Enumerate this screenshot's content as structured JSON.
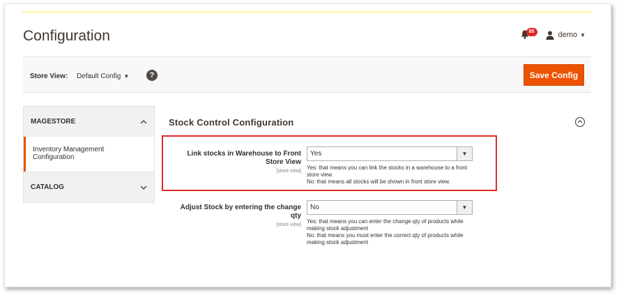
{
  "header": {
    "title": "Configuration",
    "notifications_count": "85",
    "user_name": "demo"
  },
  "toolbar": {
    "store_view_label": "Store View:",
    "store_view_value": "Default Config",
    "help_glyph": "?",
    "save_label": "Save Config"
  },
  "sidebar": {
    "groups": [
      {
        "label": "MAGESTORE",
        "expanded": true,
        "items": [
          "Inventory Management Configuration"
        ]
      },
      {
        "label": "CATALOG",
        "expanded": false,
        "items": []
      }
    ]
  },
  "section": {
    "title": "Stock Control Configuration",
    "fields": [
      {
        "label": "Link stocks in Warehouse to Front Store View",
        "scope": "[store view]",
        "value": "Yes",
        "note_lines": [
          "Yes: that means you can link the stocks in a warehouse to a front store view.",
          "No: that means all stocks will be shown in front store view."
        ]
      },
      {
        "label": "Adjust Stock by entering the change qty",
        "scope": "[store view]",
        "value": "No",
        "note_lines": [
          "Yes: that means you can enter the change qty of products while making stock adjustment",
          "No: that means you must enter the correct qty of products while making stock adjustment"
        ]
      }
    ]
  },
  "icons": {
    "bell": "bell-icon",
    "user": "user-icon",
    "help": "help-icon",
    "chevron_up": "chevron-up-icon",
    "chevron_down": "chevron-down-icon",
    "collapse": "collapse-up-icon",
    "dropdown": "dropdown-arrow-icon"
  },
  "colors": {
    "accent": "#eb5202",
    "highlight": "#e02b27",
    "badge": "#e22626"
  }
}
